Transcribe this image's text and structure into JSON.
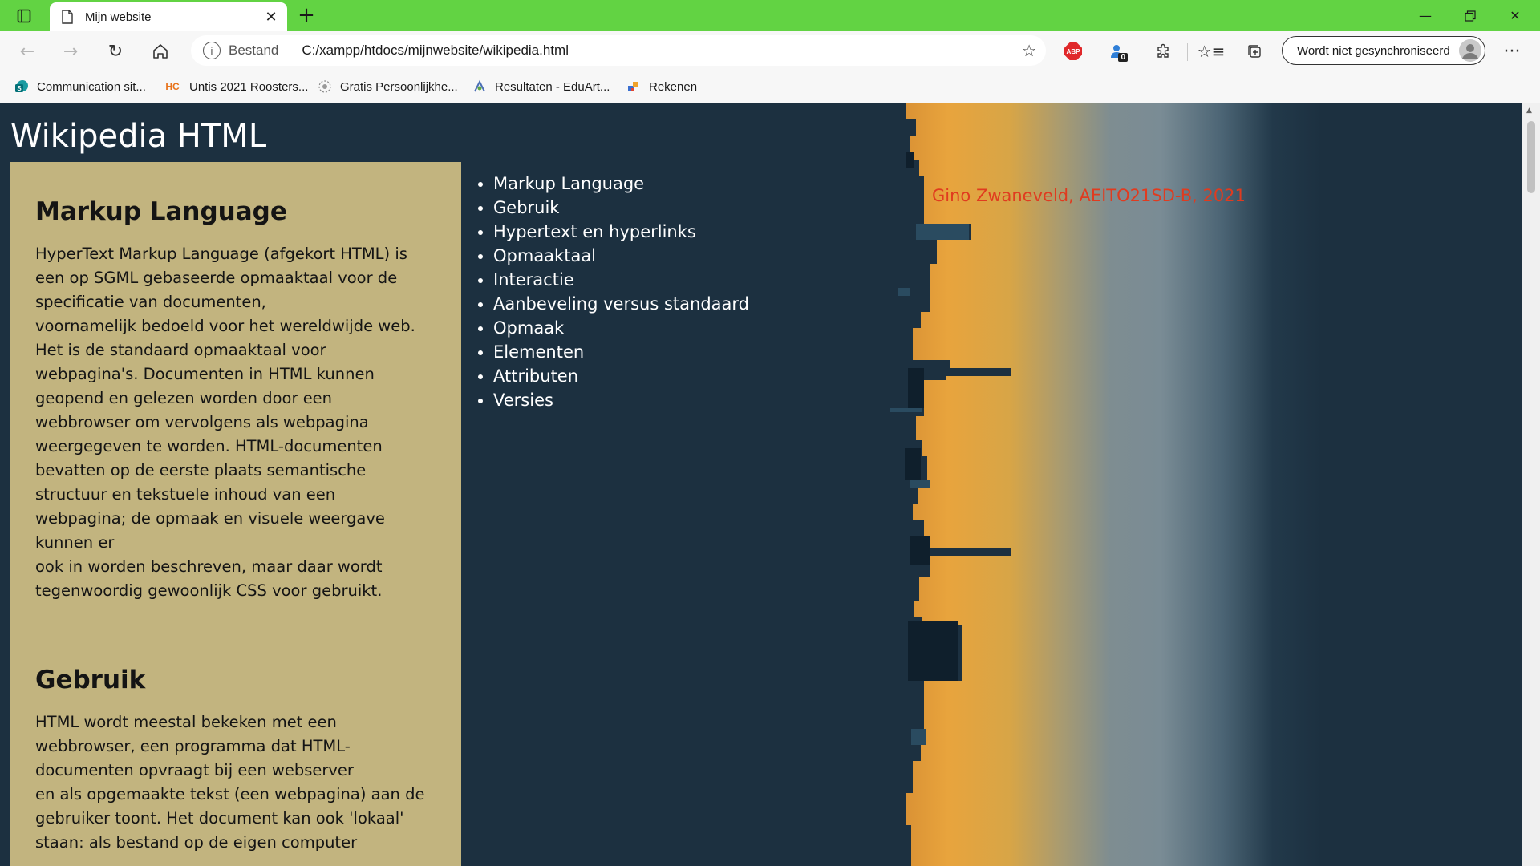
{
  "browser": {
    "tab": {
      "title": "Mijn website"
    },
    "address": {
      "security_label": "Bestand",
      "url": "C:/xampp/htdocs/mijnwebsite/wikipedia.html"
    },
    "extensions": {
      "abp_label": "ABP",
      "badge_count": "0"
    },
    "profile": {
      "sync_label": "Wordt niet gesynchroniseerd"
    },
    "bookmarks": [
      {
        "label": "Communication sit...",
        "icon": "sharepoint-icon"
      },
      {
        "label": "Untis 2021 Roosters...",
        "icon_text": "HC"
      },
      {
        "label": "Gratis Persoonlijkhe...",
        "icon": "circle-dots-icon"
      },
      {
        "label": "Resultaten - EduArt...",
        "icon": "eduarte-icon"
      },
      {
        "label": "Rekenen",
        "icon": "rekenen-icon"
      }
    ]
  },
  "page": {
    "title": "Wikipedia HTML",
    "article": [
      {
        "heading": "Markup Language",
        "paragraph_lines": [
          "HyperText Markup Language (afgekort HTML) is",
          "een op SGML gebaseerde opmaaktaal voor de",
          "specificatie van documenten,",
          "voornamelijk bedoeld voor het wereldwijde web.",
          "Het is de standaard opmaaktaal voor",
          "webpagina's. Documenten in HTML kunnen",
          "geopend en gelezen worden door een",
          "webbrowser om vervolgens als webpagina",
          "weergegeven te worden. HTML-documenten",
          "bevatten op de eerste plaats semantische",
          "structuur en tekstuele inhoud van een",
          "webpagina; de opmaak en visuele weergave",
          "kunnen er",
          "ook in worden beschreven, maar daar wordt",
          "tegenwoordig gewoonlijk CSS voor gebruikt."
        ]
      },
      {
        "heading": "Gebruik",
        "paragraph_lines": [
          "HTML wordt meestal bekeken met een",
          "webbrowser, een programma dat HTML-",
          "documenten opvraagt bij een webserver",
          "en als opgemaakte tekst (een webpagina) aan de",
          "gebruiker toont. Het document kan ook 'lokaal'",
          "staan: als bestand op de eigen computer"
        ]
      }
    ],
    "nav_items": [
      "Markup Language",
      "Gebruik",
      "Hypertext en hyperlinks",
      "Opmaaktaal",
      "Interactie",
      "Aanbeveling versus standaard",
      "Opmaak",
      "Elementen",
      "Attributen",
      "Versies"
    ],
    "author": "Gino Zwaneveld, AEITO21SD-B, 2021"
  },
  "colors": {
    "titlebar": "#62d343",
    "page_background": "#1c3040",
    "article_background": "#c2b47f",
    "author_text": "#e03b1f"
  }
}
